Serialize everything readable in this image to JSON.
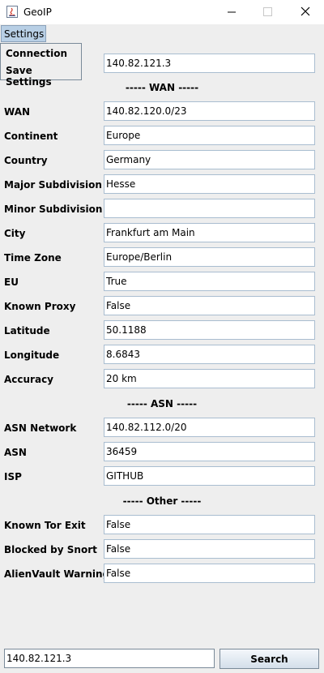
{
  "window": {
    "title": "GeoIP"
  },
  "menu": {
    "settings_label": "Settings",
    "items": [
      "Connection",
      "Save Settings"
    ]
  },
  "ip_field": {
    "value": "140.82.121.3"
  },
  "sections": {
    "wan": "----- WAN -----",
    "asn": "----- ASN -----",
    "other": "----- Other -----"
  },
  "wan_rows": [
    {
      "label": "WAN",
      "value": "140.82.120.0/23"
    },
    {
      "label": "Continent",
      "value": "Europe"
    },
    {
      "label": "Country",
      "value": "Germany"
    },
    {
      "label": "Major Subdivision",
      "value": "Hesse"
    },
    {
      "label": "Minor Subdivision",
      "value": ""
    },
    {
      "label": "City",
      "value": "Frankfurt am Main"
    },
    {
      "label": "Time Zone",
      "value": "Europe/Berlin"
    },
    {
      "label": "EU",
      "value": "True"
    },
    {
      "label": "Known Proxy",
      "value": "False"
    },
    {
      "label": "Latitude",
      "value": "50.1188"
    },
    {
      "label": "Longitude",
      "value": "8.6843"
    },
    {
      "label": "Accuracy",
      "value": "20 km"
    }
  ],
  "asn_rows": [
    {
      "label": "ASN Network",
      "value": "140.82.112.0/20"
    },
    {
      "label": "ASN",
      "value": "36459"
    },
    {
      "label": "ISP",
      "value": "GITHUB"
    }
  ],
  "other_rows": [
    {
      "label": "Known Tor Exit",
      "value": "False"
    },
    {
      "label": "Blocked by Snort",
      "value": "False"
    },
    {
      "label": "AlienVault Warning",
      "value": "False"
    }
  ],
  "search": {
    "input_value": "140.82.121.3",
    "button_label": "Search"
  }
}
